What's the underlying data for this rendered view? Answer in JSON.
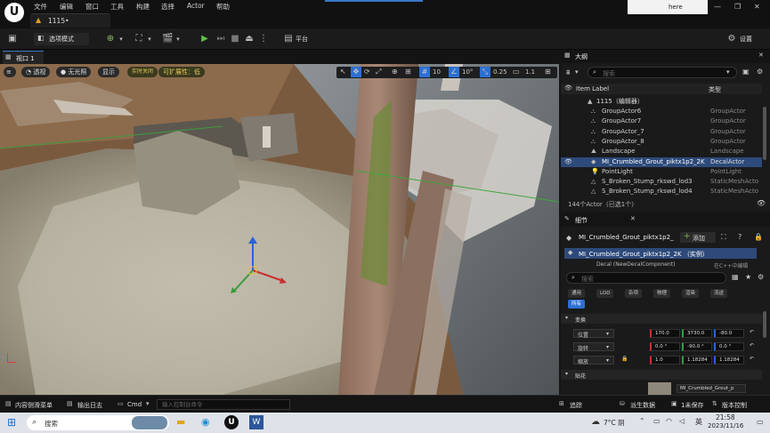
{
  "app": {
    "menus": [
      "文件",
      "编辑",
      "窗口",
      "工具",
      "构建",
      "选择",
      "Actor",
      "帮助"
    ],
    "doc_tab": "1115•",
    "search_here": "here",
    "window_controls": [
      "—",
      "❐",
      "✕"
    ]
  },
  "toolbar": {
    "mode_label": "选项模式",
    "platform_label": "平台",
    "settings_label": "设置"
  },
  "viewport": {
    "tab_label": "视口 1",
    "buttons": {
      "perspective": "透视",
      "unlit": "无光照",
      "show": "显示",
      "realtime": "实时关闭",
      "scalability": "可扩展性：低"
    },
    "grid_snap": "10",
    "rot_snap": "10°",
    "scale_snap": "0.25",
    "cam_speed": "1.1"
  },
  "outliner": {
    "title": "大纲",
    "search_placeholder": "搜索",
    "col_label": "Item Label",
    "col_type": "类型",
    "root": "1115（编辑器）",
    "rows": [
      {
        "name": "GroupActor6",
        "type": "GroupActor",
        "icon": "group-icon"
      },
      {
        "name": "GroupActor7",
        "type": "GroupActor",
        "icon": "group-icon"
      },
      {
        "name": "GroupActor_7",
        "type": "GroupActor",
        "icon": "group-icon"
      },
      {
        "name": "GroupActor_8",
        "type": "GroupActor",
        "icon": "group-icon"
      },
      {
        "name": "Landscape",
        "type": "Landscape",
        "icon": "landscape-icon"
      },
      {
        "name": "MI_Crumbled_Grout_piktx1p2_2K",
        "type": "DecalActor",
        "icon": "decal-icon"
      },
      {
        "name": "PointLight",
        "type": "PointLight",
        "icon": "light-icon"
      },
      {
        "name": "S_Broken_Stump_rkswd_lod3",
        "type": "StaticMeshActo",
        "icon": "mesh-icon"
      },
      {
        "name": "S_Broken_Stump_rkswd_lod4",
        "type": "StaticMeshActo",
        "icon": "mesh-icon"
      }
    ],
    "footer": "144个Actor（已选1个）"
  },
  "details": {
    "title": "细节",
    "actor_name": "MI_Crumbled_Grout_piktx1p2_",
    "add_label": "添加",
    "instance_row": "MI_Crumbled_Grout_piktx1p2_2K （实例）",
    "component_row": "Decal (NewDecalComponent)",
    "component_hint": "在C++中编辑",
    "search_placeholder": "搜索",
    "filters": [
      "通用",
      "LOD",
      "杂项",
      "物理",
      "渲染",
      "流送"
    ],
    "filter_all": "所有",
    "section_transform": "变换",
    "transform": [
      {
        "label": "位置",
        "x": "170.0",
        "y": "3730.0",
        "z": "-80.0"
      },
      {
        "label": "旋转",
        "x": "0.0 °",
        "y": "-90.0 °",
        "z": "0.0 °"
      },
      {
        "label": "缩放",
        "x": "1.0",
        "y": "1.18284",
        "z": "1.18284"
      }
    ],
    "section_decal": "贴花",
    "decal_material": "MI_Crumbled_Grout_p"
  },
  "statusbar": {
    "content_drawer": "内容侧滑菜单",
    "output_log": "输出日志",
    "cmd": "Cmd",
    "console_placeholder": "输入控制台命令",
    "trace": "追踪",
    "derived_data": "派生数据",
    "unsaved": "1未保存",
    "version_control": "版本控制"
  },
  "taskbar": {
    "search": "搜索",
    "weather": "7°C 阴",
    "lang": "英",
    "time": "21:58",
    "date": "2023/11/16"
  }
}
